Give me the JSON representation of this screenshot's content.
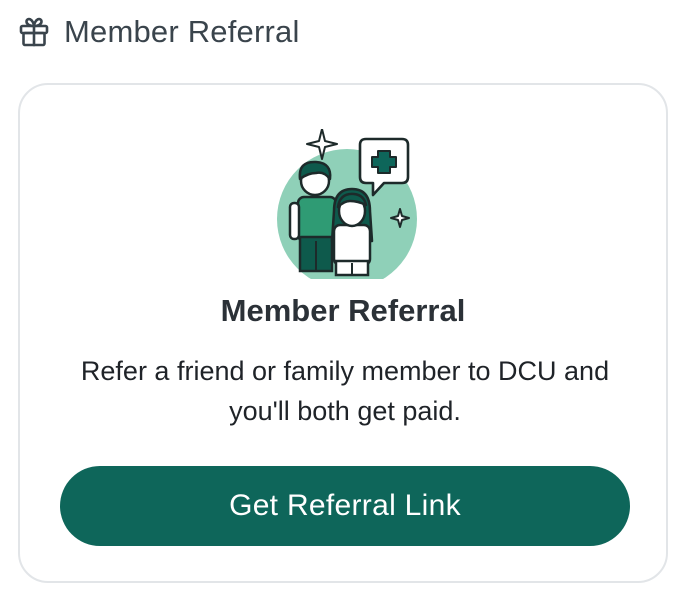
{
  "header": {
    "title": "Member Referral",
    "icon": "gift-icon"
  },
  "card": {
    "illustration": "friends-referral-illustration",
    "title": "Member Referral",
    "description": "Refer a friend or family member to DCU and you'll both get paid.",
    "button_label": "Get Referral Link"
  },
  "colors": {
    "brand": "#0e665a",
    "illustration_circle": "#8fd0b8",
    "text_dark": "#2b3137",
    "border": "#e2e5e8"
  }
}
